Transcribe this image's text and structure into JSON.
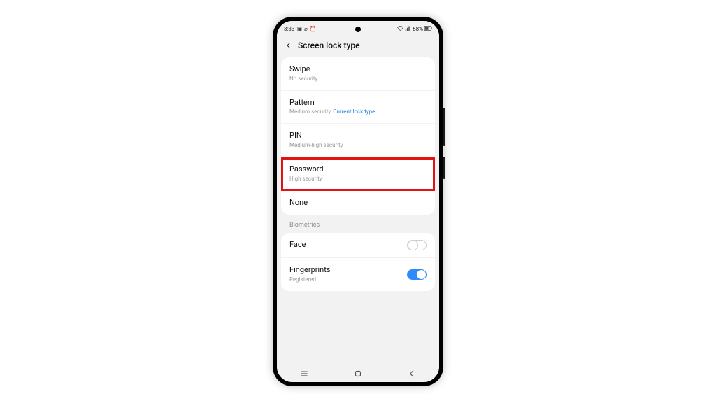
{
  "statusbar": {
    "time": "3:33",
    "battery": "58%"
  },
  "header": {
    "title": "Screen lock type"
  },
  "lockTypes": {
    "swipe": {
      "title": "Swipe",
      "sub": "No security"
    },
    "pattern": {
      "title": "Pattern",
      "sub": "Medium security, ",
      "current": "Current lock type"
    },
    "pin": {
      "title": "PIN",
      "sub": "Medium-high security"
    },
    "password": {
      "title": "Password",
      "sub": "High security"
    },
    "none": {
      "title": "None"
    }
  },
  "sections": {
    "biometrics": "Biometrics"
  },
  "biometrics": {
    "face": {
      "title": "Face",
      "enabled": false
    },
    "fingerprints": {
      "title": "Fingerprints",
      "sub": "Registered",
      "enabled": true
    }
  }
}
